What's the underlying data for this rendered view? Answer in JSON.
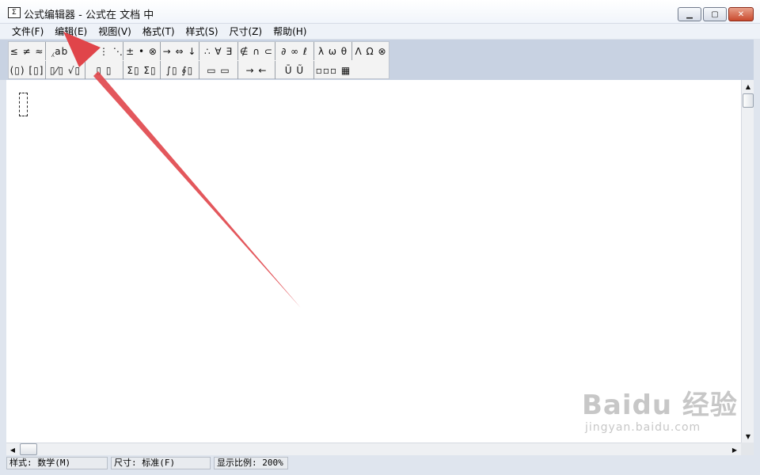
{
  "window": {
    "title": "公式编辑器 - 公式在 文档 中",
    "icon_glyph": "Σ"
  },
  "menu": {
    "items": [
      "文件(F)",
      "编辑(E)",
      "视图(V)",
      "格式(T)",
      "样式(S)",
      "尺寸(Z)",
      "帮助(H)"
    ]
  },
  "toolbar": {
    "row1": [
      "≤ ≠ ≈",
      "⁁ab ∵",
      "⋰ ⋮ ⋱",
      "± • ⊗",
      "→ ⇔ ↓",
      "∴ ∀ ∃",
      "∉ ∩ ⊂",
      "∂ ∞ ℓ",
      "λ ω θ",
      "Λ Ω ⊗"
    ],
    "row2": [
      "(▯) [▯]",
      "▯⁄▯ √▯",
      "▯ ▯",
      "Σ▯ Σ▯",
      "∫▯ ∮▯",
      "▭ ▭",
      "→ ←",
      "Ū Ũ",
      "▫▫▫ ▦"
    ]
  },
  "status": {
    "style": "样式: 数学(M)",
    "size": "尺寸: 标准(F)",
    "zoom": "显示比例: 200%"
  },
  "watermark": {
    "logo": "Baidu 经验",
    "url": "jingyan.baidu.com"
  },
  "colors": {
    "annotation_arrow": "#e0454a",
    "toolbar_background": "#c8d2e2"
  }
}
